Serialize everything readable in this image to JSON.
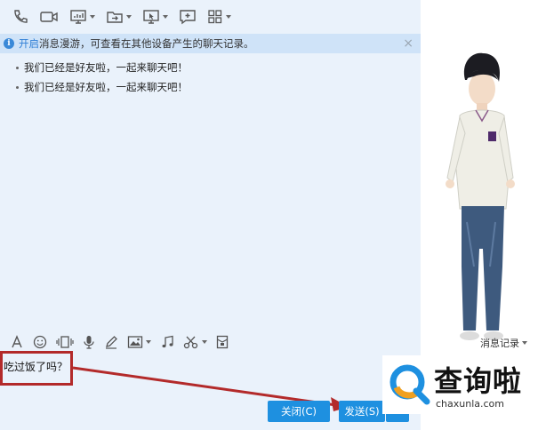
{
  "notice": {
    "link_text": "开启",
    "text": "消息漫游，可查看在其他设备产生的聊天记录。",
    "close": "×"
  },
  "messages": [
    {
      "text": "我们已经是好友啦，一起来聊天吧！"
    },
    {
      "text": "我们已经是好友啦，一起来聊天吧！"
    }
  ],
  "edit_toolbar": {
    "history_label": "消息记录"
  },
  "input": {
    "value": "吃过饭了吗？"
  },
  "buttons": {
    "close_label": "关闭(C)",
    "send_label": "发送(S)"
  },
  "watermark": {
    "title": "查询啦",
    "url": "chaxunla.com"
  },
  "colors": {
    "accent": "#1e90e0",
    "annotation": "#b32a2a",
    "notice_bg": "#cfe3f8"
  }
}
